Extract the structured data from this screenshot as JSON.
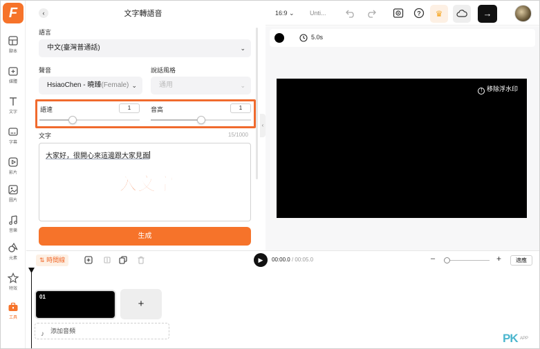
{
  "app": {
    "logo": "F"
  },
  "rail": {
    "items": [
      {
        "label": "腳本",
        "icon": "script-icon"
      },
      {
        "label": "媒體",
        "icon": "media-icon"
      },
      {
        "label": "文字",
        "icon": "text-icon"
      },
      {
        "label": "字幕",
        "icon": "subtitle-icon"
      },
      {
        "label": "影片",
        "icon": "video-icon"
      },
      {
        "label": "圖片",
        "icon": "image-icon"
      },
      {
        "label": "音樂",
        "icon": "music-icon"
      },
      {
        "label": "元素",
        "icon": "elements-icon"
      },
      {
        "label": "特效",
        "icon": "effects-icon"
      },
      {
        "label": "工具",
        "icon": "tools-icon"
      }
    ],
    "active_color": "#f6732a"
  },
  "panel": {
    "title": "文字轉語音",
    "language_label": "語言",
    "language_value": "中文(臺灣普通話)",
    "voice_label": "聲音",
    "voice_value": "HsiaoChen - 曉臻",
    "voice_gender": "(Female)",
    "style_label": "說話風格",
    "style_value": "通用",
    "speed_label": "語速",
    "speed_value": "1",
    "speed_level": 0.33,
    "pitch_label": "音高",
    "pitch_value": "1",
    "pitch_level": 0.5,
    "text_label": "文字",
    "char_count": "15/1000",
    "text_value": "大家好，很開心來這邊跟大家見面",
    "overlay_caption": "輸入文字",
    "generate_label": "生成"
  },
  "topbar": {
    "aspect": "16:9",
    "project_name": "Unti...",
    "accent": "#f6732a"
  },
  "canvas": {
    "duration": "5.0s",
    "watermark_label": "移除浮水印"
  },
  "timeline": {
    "time_tag": "時間線",
    "current_time": "00:00.0",
    "total_time": "/ 00:05.0",
    "fit_label": "適應",
    "clip_number": "01",
    "add_clip": "+",
    "add_audio_label": "添加音頻"
  },
  "watermark_logo": {
    "text": "PK",
    "sub": "APP"
  }
}
